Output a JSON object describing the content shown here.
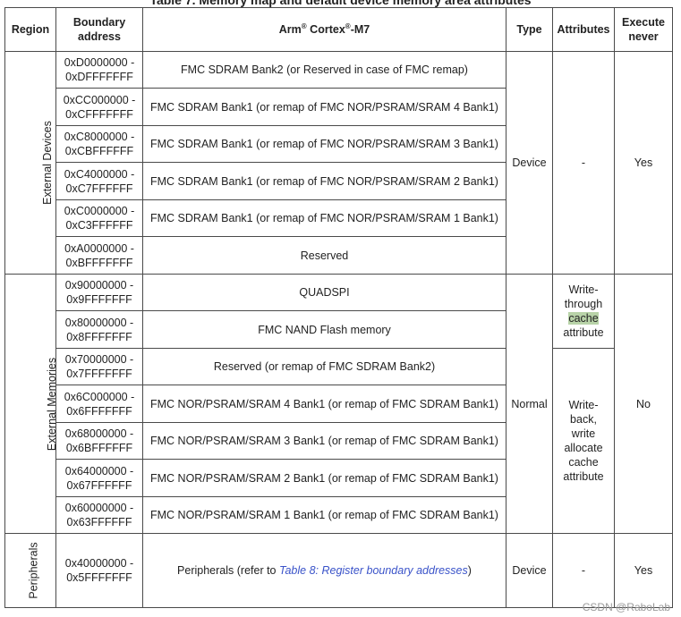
{
  "caption": "Table 7. Memory map and default device memory area attributes",
  "headers": {
    "region": "Region",
    "boundary": "Boundary address",
    "cortex_prefix": "Arm",
    "cortex_mid": " Cortex",
    "cortex_suffix": "-M7",
    "reg_mark": "®",
    "type": "Type",
    "attributes": "Attributes",
    "execute_never": "Execute never"
  },
  "groups": {
    "external_devices": {
      "region": "External Devices",
      "type": "Device",
      "attribute": "-",
      "execute_never": "Yes",
      "rows": [
        {
          "addr_start": "0xD0000000 -",
          "addr_end": "0xDFFFFFFF",
          "desc": "FMC SDRAM Bank2 (or Reserved in case of FMC remap)"
        },
        {
          "addr_start": "0xCC000000 -",
          "addr_end": "0xCFFFFFFF",
          "desc": "FMC SDRAM Bank1 (or remap of FMC NOR/PSRAM/SRAM 4 Bank1)"
        },
        {
          "addr_start": "0xC8000000 -",
          "addr_end": "0xCBFFFFFF",
          "desc": "FMC SDRAM Bank1 (or remap of FMC NOR/PSRAM/SRAM 3 Bank1)"
        },
        {
          "addr_start": "0xC4000000 -",
          "addr_end": "0xC7FFFFFF",
          "desc": "FMC SDRAM Bank1 (or remap of FMC NOR/PSRAM/SRAM 2 Bank1)"
        },
        {
          "addr_start": "0xC0000000 -",
          "addr_end": "0xC3FFFFFF",
          "desc": "FMC SDRAM Bank1 (or remap of FMC NOR/PSRAM/SRAM 1 Bank1)"
        },
        {
          "addr_start": "0xA0000000 -",
          "addr_end": "0xBFFFFFFF",
          "desc": "Reserved"
        }
      ]
    },
    "external_memories": {
      "region": "External Memories",
      "type": "Normal",
      "attr_wt_1": "Write-",
      "attr_wt_2": "through",
      "attr_wt_3": "cache",
      "attr_wt_4": "attribute",
      "attr_wb_1": "Write-",
      "attr_wb_2": "back,",
      "attr_wb_3": "write",
      "attr_wb_4": "allocate",
      "attr_wb_5": "cache",
      "attr_wb_6": "attribute",
      "execute_never": "No",
      "rows": [
        {
          "addr_start": "0x90000000 -",
          "addr_end": "0x9FFFFFFF",
          "desc": "QUADSPI"
        },
        {
          "addr_start": "0x80000000 -",
          "addr_end": "0x8FFFFFFF",
          "desc": "FMC NAND Flash memory"
        },
        {
          "addr_start": "0x70000000 -",
          "addr_end": "0x7FFFFFFF",
          "desc": "Reserved (or remap of FMC SDRAM Bank2)"
        },
        {
          "addr_start": "0x6C000000 -",
          "addr_end": "0x6FFFFFFF",
          "desc": "FMC NOR/PSRAM/SRAM 4 Bank1 (or remap of FMC SDRAM Bank1)"
        },
        {
          "addr_start": "0x68000000 -",
          "addr_end": "0x6BFFFFFF",
          "desc": "FMC NOR/PSRAM/SRAM 3 Bank1 (or remap of FMC SDRAM Bank1)"
        },
        {
          "addr_start": "0x64000000 -",
          "addr_end": "0x67FFFFFF",
          "desc": "FMC NOR/PSRAM/SRAM 2 Bank1 (or remap of FMC SDRAM Bank1)"
        },
        {
          "addr_start": "0x60000000 -",
          "addr_end": "0x63FFFFFF",
          "desc": "FMC NOR/PSRAM/SRAM 1 Bank1 (or remap of FMC SDRAM Bank1)"
        }
      ]
    },
    "peripherals": {
      "region": "Peripherals",
      "addr_start": "0x40000000 -",
      "addr_end": "0x5FFFFFFF",
      "desc_prefix": "Peripherals (refer to ",
      "desc_link": "Table 8: Register boundary addresses",
      "desc_suffix": ")",
      "type": "Device",
      "attribute": "-",
      "execute_never": "Yes"
    }
  },
  "watermark": "CSDN @RaboLab",
  "colors": {
    "link": "#3a53c9",
    "highlight": "#b8d3a8",
    "border": "#4a4a4a"
  }
}
